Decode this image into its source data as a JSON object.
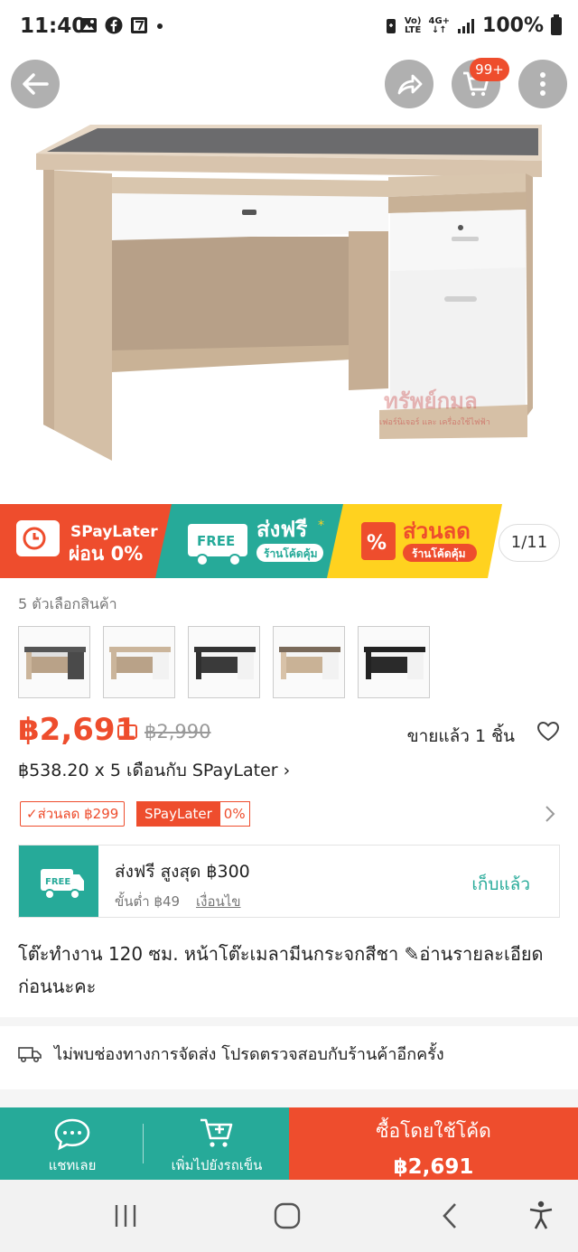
{
  "status_bar": {
    "time": "11:40",
    "network_top": "Vo)",
    "network_bottom": "LTE",
    "signal_top": "4G+",
    "signal_bottom": "↓↑",
    "battery": "100%"
  },
  "product_image": {
    "watermark_main": "ทรัพย์กมล",
    "watermark_sub": "เฟอร์นิเจอร์ และ เครื่องใช้ไฟฟ้า",
    "cart_badge": "99+"
  },
  "promo_banner": {
    "spaylater_title": "SPayLater",
    "spaylater_sub": "ผ่อน 0%",
    "free_badge": "FREE",
    "free_ship_title": "ส่งฟรี",
    "free_ship_star": "*",
    "free_ship_sub": "ร้านโค้ดคุ้ม",
    "discount_title": "ส่วนลด",
    "discount_sub": "ร้านโค้ดคุ้ม",
    "discount_pct": "%",
    "counter": "1/11"
  },
  "variants": {
    "label": "5 ตัวเลือกสินค้า"
  },
  "price": {
    "current": "฿2,691",
    "tag": "฿",
    "original": "฿2,990",
    "sold": "ขายแล้ว 1 ชิ้น",
    "installment": "฿538.20 x 5 เดือนกับ SPayLater",
    "installment_chevron": "›"
  },
  "coupons": {
    "discount": "✓ส่วนลด ฿299",
    "spaylater": "SPayLater",
    "spaylater_pct": "0%"
  },
  "voucher": {
    "icon_text": "FREE",
    "title": "ส่งฟรี สูงสุด ฿300",
    "min_spend": "ขั้นต่ำ ฿49",
    "conditions": "เงื่อนไข",
    "collect": "เก็บแล้ว"
  },
  "title": "โต๊ะทำงาน 120 ซม. หน้าโต๊ะเมลามีนกระจกสีชา ✎อ่านรายละเอียดก่อนนะคะ",
  "shipping_notice": "ไม่พบช่องทางการจัดส่ง โปรดตรวจสอบกับร้านค้าอีกครั้ง",
  "bottom_bar": {
    "chat": "แชทเลย",
    "add_cart": "เพิ่มไปยังรถเข็น",
    "buy_title": "ซื้อโดยใช้โค้ด",
    "buy_price": "฿2,691"
  },
  "colors": {
    "shopee_orange": "#ee4d2d",
    "teal": "#26aa99",
    "yellow": "#ffd21f"
  }
}
